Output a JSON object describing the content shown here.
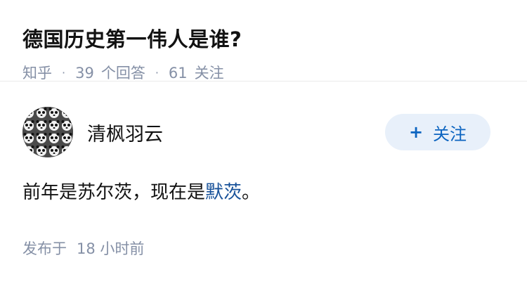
{
  "question": {
    "title": "德国历史第一伟人是谁?",
    "site": "知乎",
    "separator": "·",
    "answer_count": "39",
    "answer_label": "个回答",
    "follower_count": "61",
    "follower_label": "关注"
  },
  "answer": {
    "author_name": "清枫羽云",
    "follow_plus": "+",
    "follow_label": "关注",
    "content_prefix": "前年是苏尔茨，现在是",
    "content_link": "默茨",
    "content_suffix": "。",
    "published_label": "发布于",
    "published_time": "18 小时前"
  },
  "colors": {
    "accent": "#0c64c0",
    "link": "#175199",
    "meta": "#8590a6",
    "follow_bg": "#e8f0fa"
  }
}
